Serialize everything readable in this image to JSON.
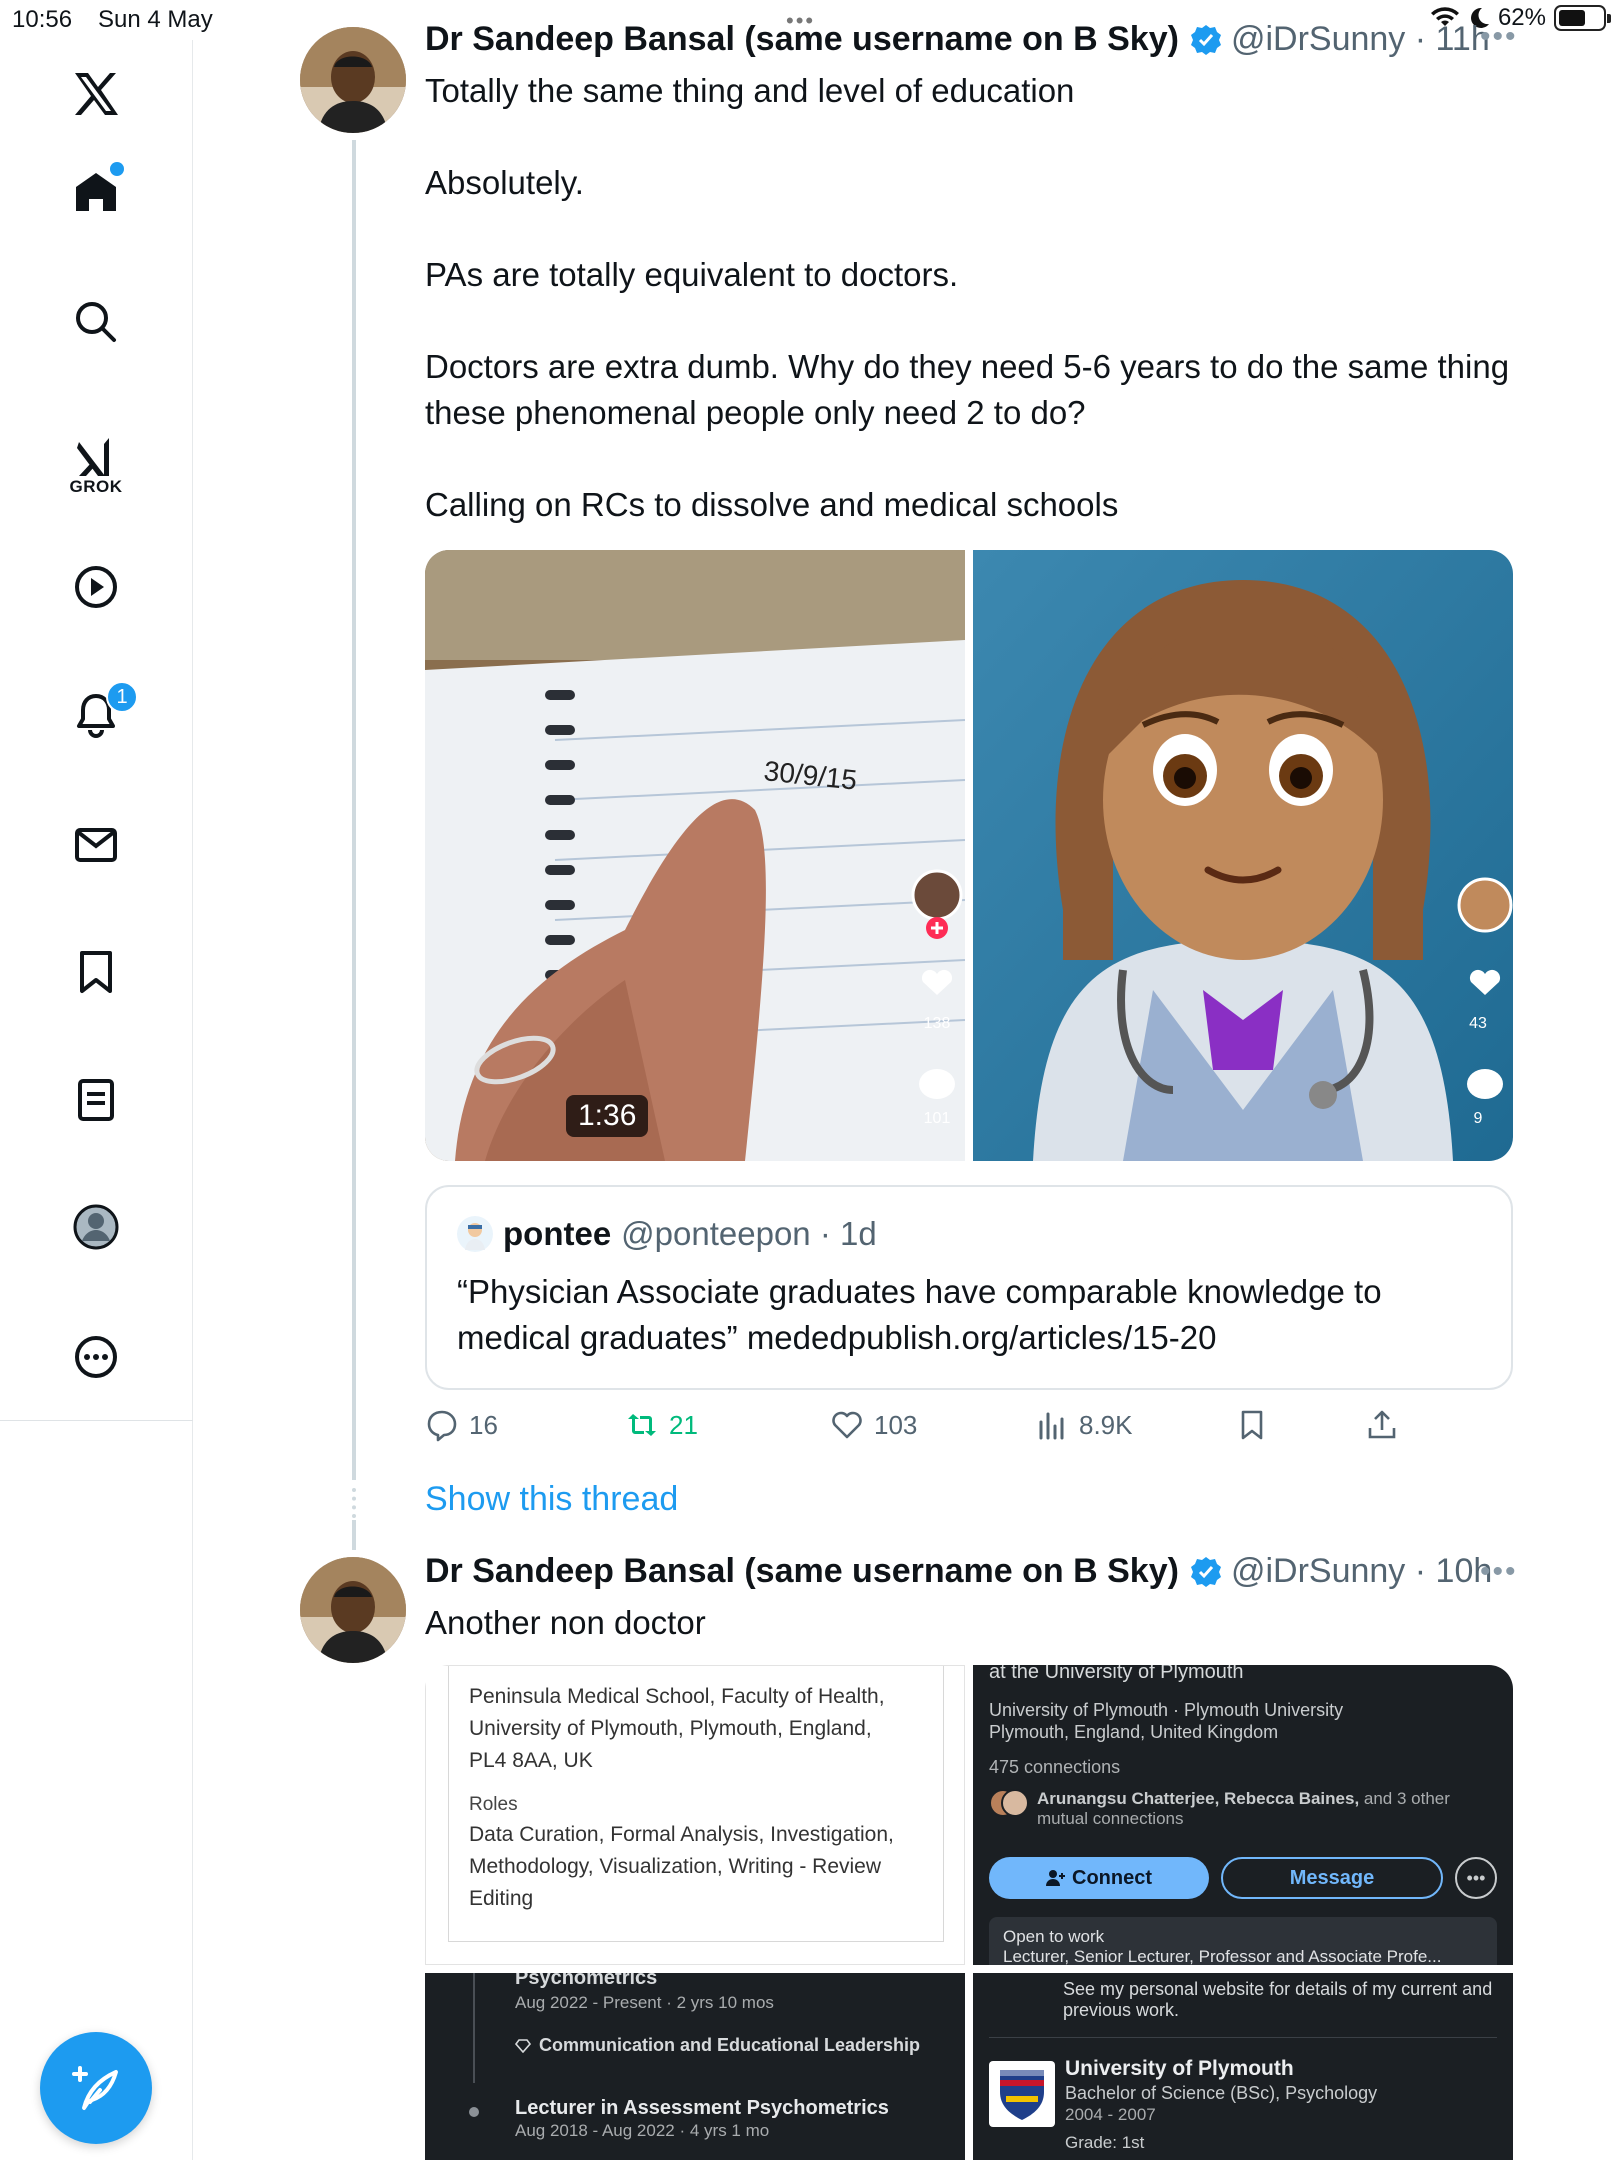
{
  "status_bar": {
    "time": "10:56",
    "date": "Sun 4 May",
    "battery": "62%",
    "battery_level": 0.62
  },
  "sidebar": {
    "items": [
      {
        "icon": "x-logo-icon"
      },
      {
        "icon": "home-icon",
        "has_dot": true
      },
      {
        "icon": "search-icon"
      },
      {
        "icon": "grok-icon",
        "label": "GROK"
      },
      {
        "icon": "video-icon"
      },
      {
        "icon": "notifications-icon",
        "badge": "1"
      },
      {
        "icon": "messages-icon"
      },
      {
        "icon": "bookmarks-icon"
      },
      {
        "icon": "lists-icon"
      },
      {
        "icon": "profile-icon"
      },
      {
        "icon": "more-icon"
      }
    ],
    "compose_icon": "compose-icon"
  },
  "tweet1": {
    "name": "Dr Sandeep Bansal (same username on B Sky)",
    "handle": "@iDrSunny",
    "time": "11h",
    "paragraphs": [
      "Totally the same thing and level of education",
      "Absolutely.",
      "PAs are totally equivalent to doctors.",
      "Doctors are extra dumb. Why do they need 5-6 years to do the same thing these phenomenal people only need 2 to do?",
      "Calling on RCs to dissolve and medical schools"
    ],
    "media": {
      "left": {
        "notebook_date": "30/9/15",
        "likes": "138",
        "comments": "101"
      },
      "right": {
        "likes": "43",
        "comments": "9"
      },
      "duration": "1:36"
    },
    "quote": {
      "name": "pontee",
      "handle": "@ponteepon",
      "time": "1d",
      "text": "“Physician Associate graduates have comparable knowledge to medical graduates” mededpublish.org/articles/15-20"
    },
    "actions": {
      "replies": "16",
      "retweets": "21",
      "likes": "103",
      "views": "8.9K"
    },
    "show_thread": "Show this thread"
  },
  "tweet2": {
    "name": "Dr Sandeep Bansal (same username on B Sky)",
    "handle": "@iDrSunny",
    "time": "10h",
    "text": "Another non doctor",
    "images": {
      "affiliation": {
        "lines": [
          "Peninsula Medical School, Faculty of Health,",
          "University of Plymouth, Plymouth, England,",
          "PL4 8AA, UK"
        ],
        "roles_label": "Roles",
        "roles": [
          "Data Curation, Formal Analysis, Investigation,",
          "Methodology, Visualization, Writing - Review",
          "Editing"
        ]
      },
      "profile": {
        "top": "at the University of Plymouth",
        "org_line1": "University of Plymouth · Plymouth University",
        "org_line2": "Plymouth, England, United Kingdom",
        "connections": "475 connections",
        "mutual_names": "Arunangsu Chatterjee, Rebecca Baines,",
        "mutual_rest": " and 3 other",
        "mutual_line2": "mutual connections",
        "connect": "Connect",
        "message": "Message",
        "open_to_work": "Open to work",
        "open_to_work_detail": "Lecturer, Senior Lecturer, Professor and Associate Profe..."
      },
      "experience": {
        "title": "Psychometrics",
        "dates1": "Aug 2022 - Present · 2 yrs 10 mos",
        "skill": "Communication and Educational Leadership",
        "role2": "Lecturer in Assessment Psychometrics",
        "dates2": "Aug 2018 - Aug 2022 · 4 yrs 1 mo"
      },
      "education": {
        "note": "See my personal website for details of my current and previous work.",
        "school": "University of Plymouth",
        "degree": "Bachelor of Science (BSc), Psychology",
        "years": "2004 - 2007",
        "grade": "Grade: 1st"
      }
    }
  },
  "colors": {
    "accent": "#1d9bf0",
    "retweet": "#00ba7c",
    "muted": "#536471"
  }
}
